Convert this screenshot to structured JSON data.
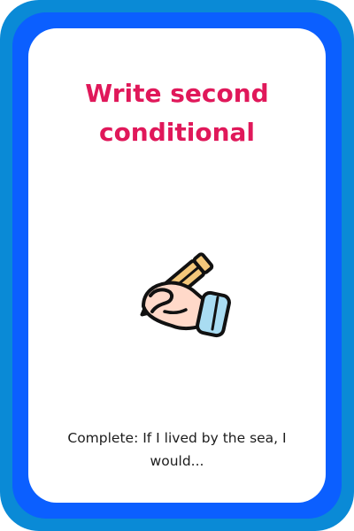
{
  "card": {
    "title": "Write second conditional",
    "prompt": "Complete: If I lived by the sea, I would...",
    "illustration_icon": "hand-writing-with-pencil-icon"
  },
  "colors": {
    "outer_frame": "#0a8ad6",
    "inner_ring": "#0b5fff",
    "title": "#e0185a",
    "text": "#1c1c1c"
  }
}
